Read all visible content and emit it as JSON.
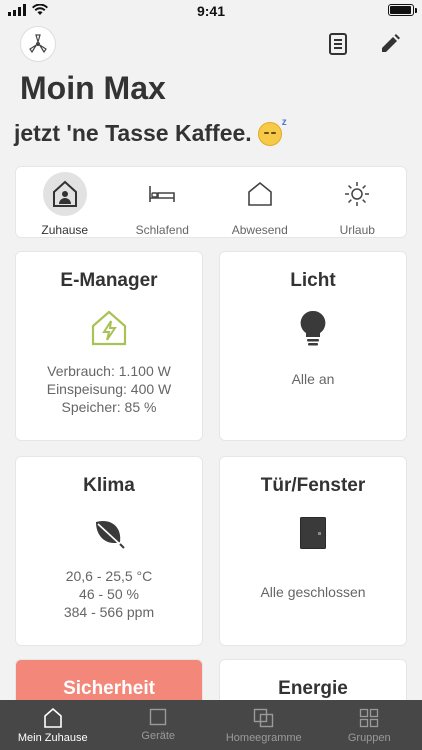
{
  "status_bar": {
    "time": "9:41"
  },
  "greeting": "Moin Max",
  "subtitle": "jetzt 'ne Tasse Kaffee.",
  "modes": [
    {
      "label": "Zuhause",
      "active": true
    },
    {
      "label": "Schlafend",
      "active": false
    },
    {
      "label": "Abwesend",
      "active": false
    },
    {
      "label": "Urlaub",
      "active": false
    }
  ],
  "cards": {
    "emanager": {
      "title": "E-Manager",
      "lines": [
        "Verbrauch: 1.100 W",
        "Einspeisung: 400 W",
        "Speicher: 85 %"
      ]
    },
    "licht": {
      "title": "Licht",
      "lines": [
        "Alle an"
      ]
    },
    "klima": {
      "title": "Klima",
      "lines": [
        "20,6 - 25,5 °C",
        "46 - 50 %",
        "384 - 566 ppm"
      ]
    },
    "tuer": {
      "title": "Tür/Fenster",
      "lines": [
        "Alle geschlossen"
      ]
    },
    "sicherheit": {
      "title": "Sicherheit"
    },
    "energie": {
      "title": "Energie"
    }
  },
  "tabs": [
    {
      "label": "Mein Zuhause",
      "active": true
    },
    {
      "label": "Geräte",
      "active": false
    },
    {
      "label": "Homeegramme",
      "active": false
    },
    {
      "label": "Gruppen",
      "active": false
    }
  ],
  "colors": {
    "accent_green": "#a8c256",
    "security_red": "#f2877a",
    "tabbar": "#474747"
  },
  "icons": {
    "top_left": "homee-logo-icon",
    "top_right": [
      "notes-icon",
      "edit-pencil-icon"
    ],
    "modes": [
      "house-person-icon",
      "bed-icon",
      "house-outline-icon",
      "sun-icon"
    ],
    "cards": [
      "house-lightning-icon",
      "lightbulb-icon",
      "leaf-icon",
      "door-icon"
    ],
    "tabs": [
      "house-icon",
      "square-icon",
      "overlap-squares-icon",
      "grid-squares-icon"
    ]
  }
}
